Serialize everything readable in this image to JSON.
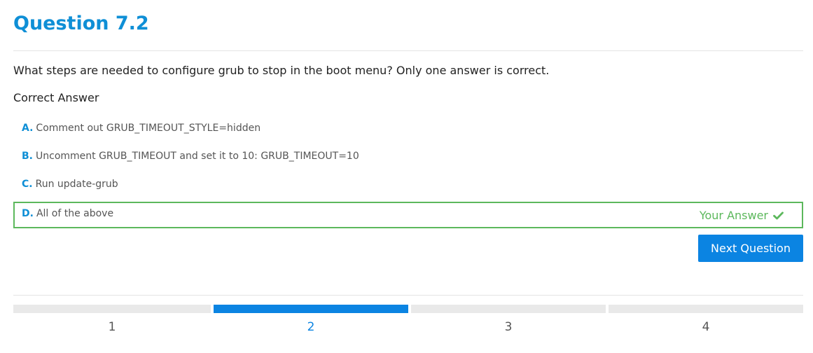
{
  "question": {
    "title": "Question 7.2",
    "text": "What steps are needed to configure grub to stop in the boot menu? Only one answer is correct.",
    "result_label": "Correct Answer"
  },
  "options": [
    {
      "letter": "A.",
      "text": "Comment out GRUB_TIMEOUT_STYLE=hidden"
    },
    {
      "letter": "B.",
      "text": "Uncomment GRUB_TIMEOUT and set it to 10: GRUB_TIMEOUT=10"
    },
    {
      "letter": "C.",
      "text": "Run update-grub"
    },
    {
      "letter": "D.",
      "text": "All of the above",
      "your_answer_label": "Your Answer",
      "selected": true,
      "correct": true
    }
  ],
  "actions": {
    "next_label": "Next Question"
  },
  "progress": {
    "steps": [
      "1",
      "2",
      "3",
      "4"
    ],
    "current_step": 2
  },
  "colors": {
    "accent": "#0b84e2",
    "title": "#0f8fd6",
    "correct": "#5cb85c",
    "inactive_bar": "#e9e9e9"
  },
  "icons": {
    "your_answer_icon": "checkmark-icon"
  }
}
